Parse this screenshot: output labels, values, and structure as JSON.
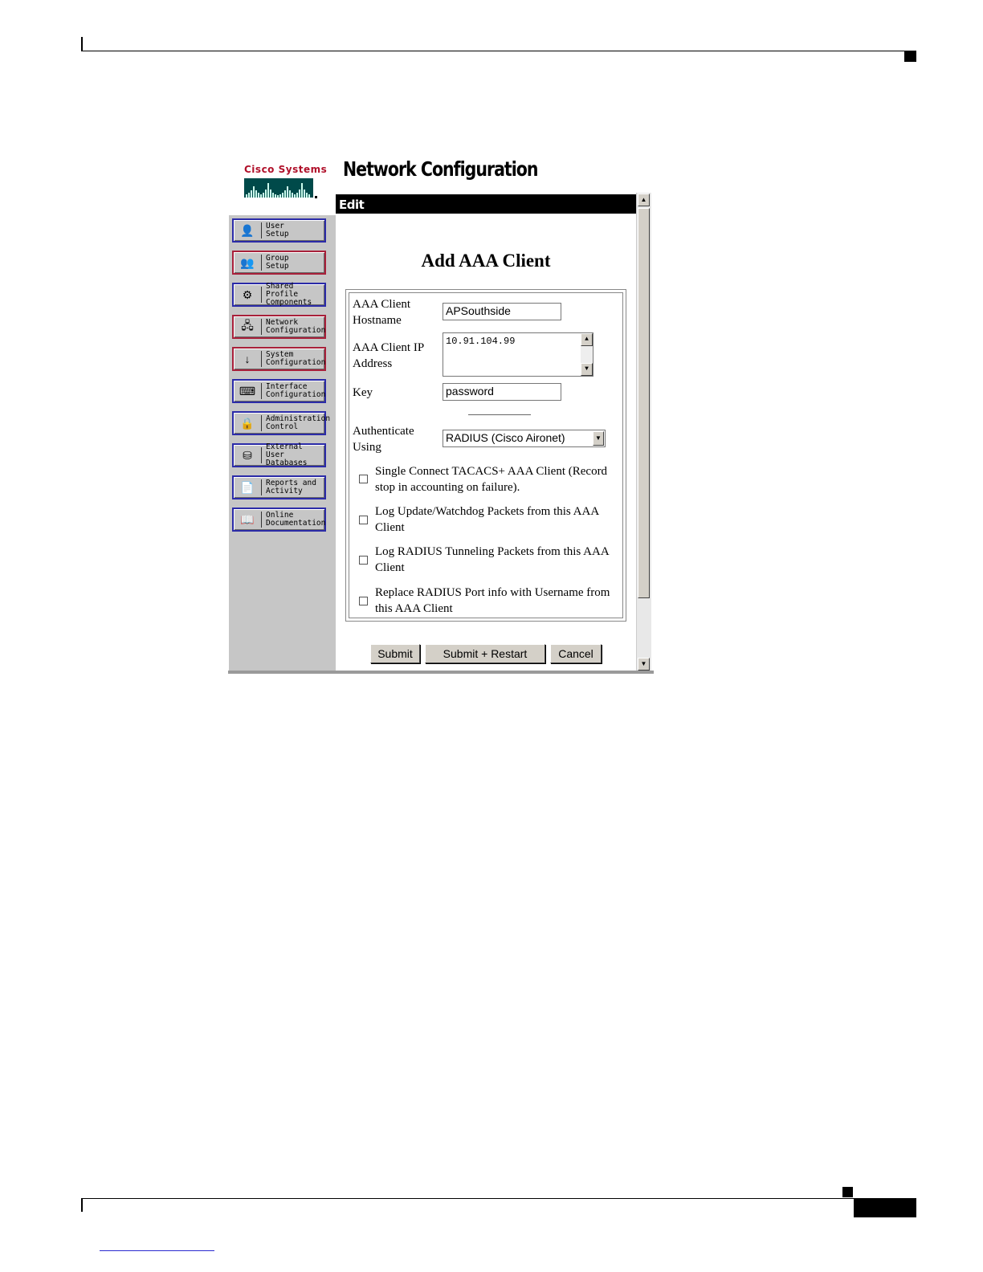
{
  "app": {
    "logo_text": "Cisco Systems",
    "title": "Network Configuration"
  },
  "sidebar": {
    "items": [
      {
        "label": "User\nSetup",
        "icon": "user-setup-icon"
      },
      {
        "label": "Group\nSetup",
        "icon": "group-setup-icon"
      },
      {
        "label": "Shared Profile\nComponents",
        "icon": "shared-profile-icon"
      },
      {
        "label": "Network\nConfiguration",
        "icon": "network-config-icon"
      },
      {
        "label": "System\nConfiguration",
        "icon": "system-config-icon"
      },
      {
        "label": "Interface\nConfiguration",
        "icon": "interface-config-icon"
      },
      {
        "label": "Administration\nControl",
        "icon": "admin-control-icon"
      },
      {
        "label": "External User\nDatabases",
        "icon": "external-db-icon"
      },
      {
        "label": "Reports and\nActivity",
        "icon": "reports-icon"
      },
      {
        "label": "Online\nDocumentation",
        "icon": "documentation-icon"
      }
    ]
  },
  "content": {
    "section": "Edit",
    "heading": "Add AAA Client",
    "form": {
      "hostname_label": "AAA Client Hostname",
      "hostname_value": "APSouthside",
      "ip_label": "AAA Client IP Address",
      "ip_value": "10.91.104.99",
      "key_label": "Key",
      "key_value": "password",
      "auth_label": "Authenticate Using",
      "auth_value": "RADIUS (Cisco Aironet)",
      "options": [
        {
          "label": "Single Connect TACACS+ AAA Client (Record stop in accounting on failure).",
          "checked": false
        },
        {
          "label": "Log Update/Watchdog Packets from this AAA Client",
          "checked": false
        },
        {
          "label": "Log RADIUS Tunneling Packets from this AAA Client",
          "checked": false
        },
        {
          "label": "Replace RADIUS Port info with Username from this AAA Client",
          "checked": false
        }
      ]
    },
    "buttons": {
      "submit": "Submit",
      "submit_restart": "Submit + Restart",
      "cancel": "Cancel"
    }
  },
  "colors": {
    "nav_border": "#2b2ba8",
    "logo_red": "#b0102a",
    "edit_bar": "#000000"
  }
}
